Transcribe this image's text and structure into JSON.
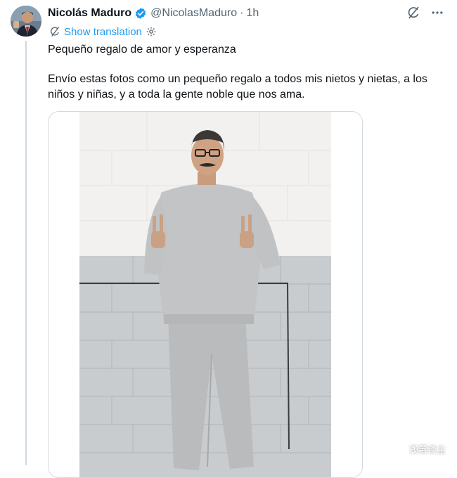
{
  "author": {
    "display_name": "Nicolás Maduro",
    "handle": "@NicolasMaduro",
    "separator": "·",
    "time": "1h",
    "verified": true,
    "avatar_icon": "profile-photo"
  },
  "translation": {
    "label": "Show translation",
    "icon": "translate-icon",
    "settings_icon": "gear-icon"
  },
  "tweet": {
    "line1": "Pequeño regalo de amor y esperanza",
    "line2": "Envío estas fotos como un pequeño regalo a todos mis nietos y nietas, a los niños y niñas, y a toda la gente noble que nos ama."
  },
  "header_icons": {
    "grok_icon": "grok-icon",
    "more_icon": "more-icon"
  },
  "media": {
    "description_icon": "photo-man-gray-sweatsuit"
  },
  "watermark": {
    "text": "浅薯谈尘"
  },
  "colors": {
    "link": "#1d9bf0",
    "secondary_text": "#536471",
    "primary_text": "#0f1419",
    "verified_blue": "#1d9bf0",
    "border": "#cfd9de"
  }
}
